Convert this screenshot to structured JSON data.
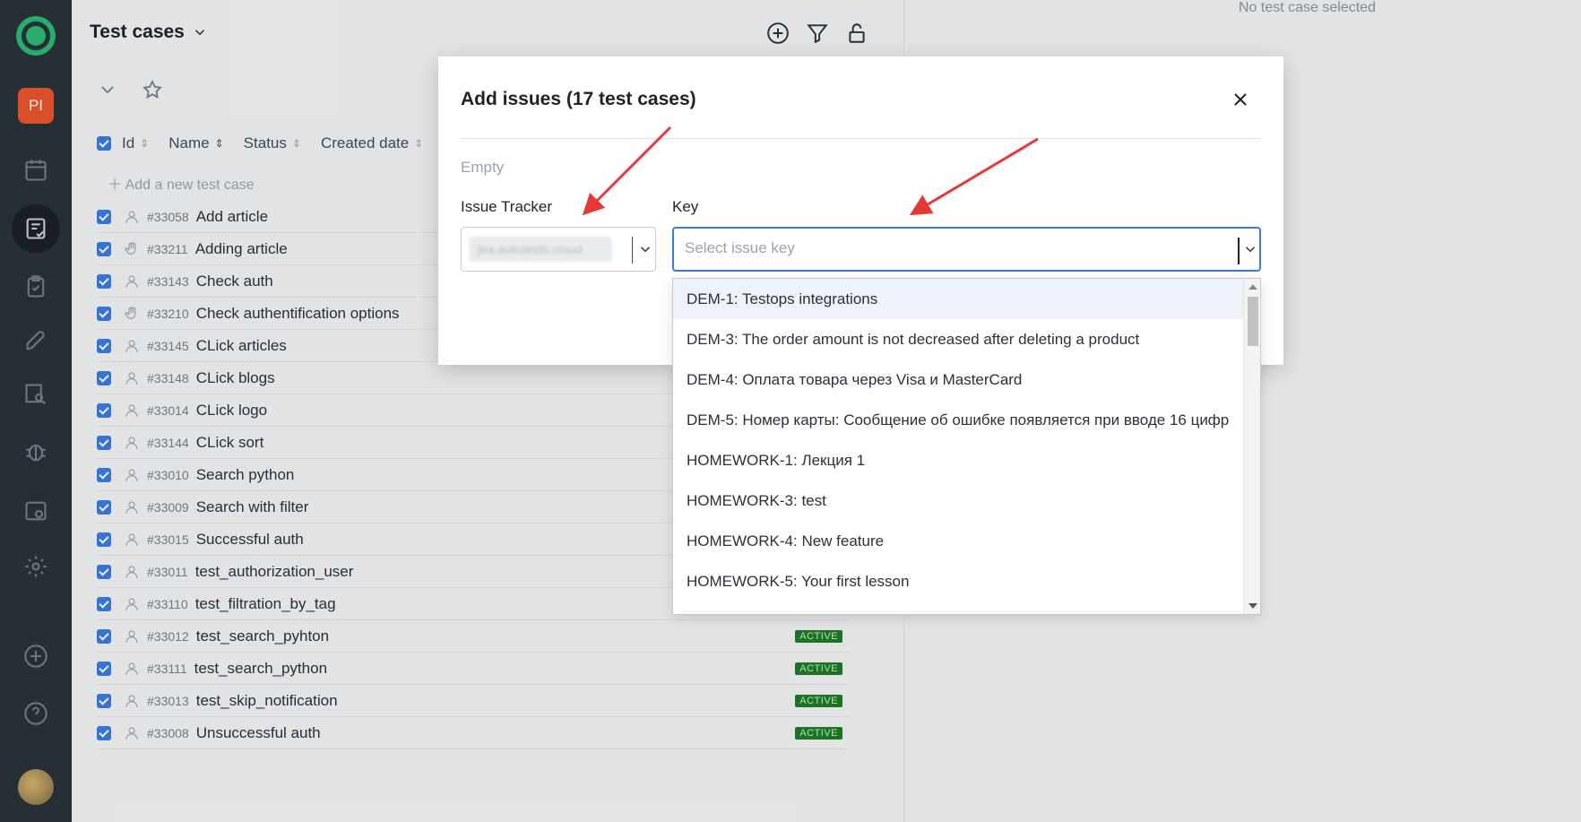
{
  "sidebar": {
    "project_badge": "PI",
    "items": [
      {
        "icon": "calendar-icon"
      },
      {
        "icon": "test-cases-icon",
        "active": true
      },
      {
        "icon": "clipboard-icon"
      },
      {
        "icon": "launch-icon"
      },
      {
        "icon": "analytics-icon"
      },
      {
        "icon": "bug-icon"
      },
      {
        "icon": "jobs-icon"
      },
      {
        "icon": "gear-icon"
      }
    ],
    "bottom": [
      {
        "icon": "add-icon"
      },
      {
        "icon": "help-icon"
      }
    ]
  },
  "list": {
    "title": "Test cases",
    "add_placeholder": "Add a new test case",
    "columns": [
      "Id",
      "Name",
      "Status",
      "Created date"
    ],
    "rows": [
      {
        "id": "#33058",
        "name": "Add article",
        "status": ""
      },
      {
        "id": "#33211",
        "name": "Adding article",
        "status": ""
      },
      {
        "id": "#33143",
        "name": "Check auth",
        "status": ""
      },
      {
        "id": "#33210",
        "name": "Check authentification options",
        "status": ""
      },
      {
        "id": "#33145",
        "name": "CLick articles",
        "status": ""
      },
      {
        "id": "#33148",
        "name": "CLick blogs",
        "status": ""
      },
      {
        "id": "#33014",
        "name": "CLick logo",
        "status": ""
      },
      {
        "id": "#33144",
        "name": "CLick sort",
        "status": ""
      },
      {
        "id": "#33010",
        "name": "Search python",
        "status": ""
      },
      {
        "id": "#33009",
        "name": "Search with filter",
        "status": ""
      },
      {
        "id": "#33015",
        "name": "Successful auth",
        "status": ""
      },
      {
        "id": "#33011",
        "name": "test_authorization_user",
        "status": ""
      },
      {
        "id": "#33110",
        "name": "test_filtration_by_tag",
        "status": ""
      },
      {
        "id": "#33012",
        "name": "test_search_pyhton",
        "status": "ACTIVE"
      },
      {
        "id": "#33111",
        "name": "test_search_python",
        "status": "ACTIVE"
      },
      {
        "id": "#33013",
        "name": "test_skip_notification",
        "status": "ACTIVE"
      },
      {
        "id": "#33008",
        "name": "Unsuccessful auth",
        "status": "ACTIVE"
      }
    ]
  },
  "detail": {
    "empty_text": "No test case selected"
  },
  "modal": {
    "title": "Add issues (17 test cases)",
    "empty_text": "Empty",
    "issue_tracker_label": "Issue Tracker",
    "issue_tracker_value": "jira.autotests.cloud",
    "key_label": "Key",
    "key_placeholder": "Select issue key",
    "options": [
      "DEM-1: Testops integrations",
      "DEM-3: The order amount is not decreased after deleting a product",
      "DEM-4: Оплата товара через Visa и MasterCard",
      "DEM-5: Номер карты: Сообщение об ошибке появляется при вводе 16 цифр",
      "HOMEWORK-1: Лекция 1",
      "HOMEWORK-3: test",
      "HOMEWORK-4: New feature",
      "HOMEWORK-5: Your first lesson"
    ]
  },
  "colors": {
    "accent": "#3a7be0",
    "active_badge": "#1e7a2a",
    "arrow": "#e53935",
    "sidebar": "#2a3138"
  }
}
